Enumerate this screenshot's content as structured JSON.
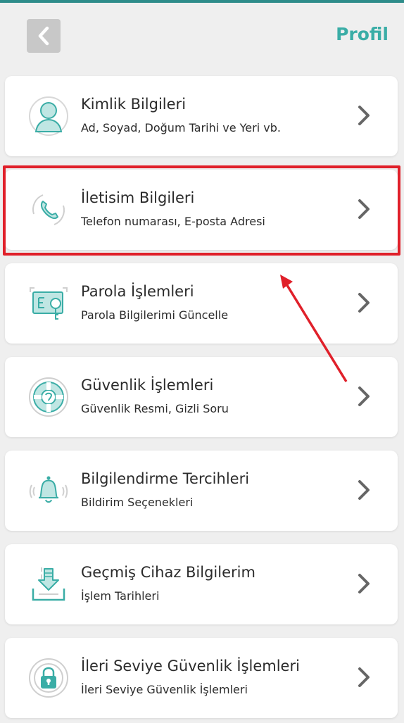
{
  "header": {
    "title": "Profil",
    "back_icon": "chevron-left-icon"
  },
  "colors": {
    "accent": "#3aada6",
    "top_strip": "#2e8c8a",
    "background": "#efefef",
    "highlight": "#e0202a",
    "icon": "#3aada6"
  },
  "menu": {
    "items": [
      {
        "title": "Kimlik Bilgileri",
        "subtitle": "Ad, Soyad, Doğum Tarihi ve Yeri vb.",
        "icon": "person-icon"
      },
      {
        "title": "İletisim Bilgileri",
        "subtitle": "Telefon numarası, E-posta Adresi",
        "icon": "phone-icon"
      },
      {
        "title": "Parola İşlemleri",
        "subtitle": "Parola Bilgilerimi Güncelle",
        "icon": "password-key-icon"
      },
      {
        "title": "Güvenlik İşlemleri",
        "subtitle": "Güvenlik Resmi, Gizli Soru",
        "icon": "lifebuoy-icon"
      },
      {
        "title": "Bilgilendirme Tercihleri",
        "subtitle": "Bildirim Seçenekleri",
        "icon": "bell-icon"
      },
      {
        "title": "Geçmiş Cihaz Bilgilerim",
        "subtitle": "İşlem Tarihleri",
        "icon": "download-tray-icon"
      },
      {
        "title": "İleri Seviye Güvenlik İşlemleri",
        "subtitle": "İleri Seviye Güvenlik İşlemleri",
        "icon": "padlock-icon"
      }
    ]
  }
}
